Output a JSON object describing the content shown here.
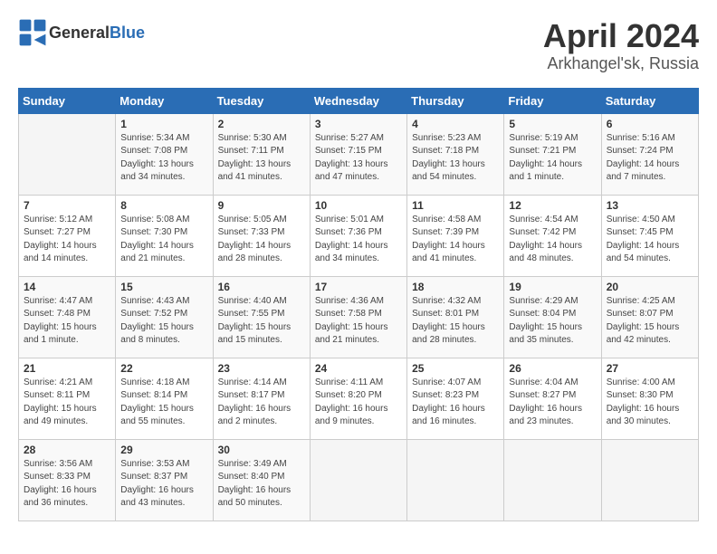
{
  "logo": {
    "general": "General",
    "blue": "Blue"
  },
  "title": "April 2024",
  "subtitle": "Arkhangel'sk, Russia",
  "days_of_week": [
    "Sunday",
    "Monday",
    "Tuesday",
    "Wednesday",
    "Thursday",
    "Friday",
    "Saturday"
  ],
  "weeks": [
    [
      {
        "day": "",
        "content": ""
      },
      {
        "day": "1",
        "content": "Sunrise: 5:34 AM\nSunset: 7:08 PM\nDaylight: 13 hours\nand 34 minutes."
      },
      {
        "day": "2",
        "content": "Sunrise: 5:30 AM\nSunset: 7:11 PM\nDaylight: 13 hours\nand 41 minutes."
      },
      {
        "day": "3",
        "content": "Sunrise: 5:27 AM\nSunset: 7:15 PM\nDaylight: 13 hours\nand 47 minutes."
      },
      {
        "day": "4",
        "content": "Sunrise: 5:23 AM\nSunset: 7:18 PM\nDaylight: 13 hours\nand 54 minutes."
      },
      {
        "day": "5",
        "content": "Sunrise: 5:19 AM\nSunset: 7:21 PM\nDaylight: 14 hours\nand 1 minute."
      },
      {
        "day": "6",
        "content": "Sunrise: 5:16 AM\nSunset: 7:24 PM\nDaylight: 14 hours\nand 7 minutes."
      }
    ],
    [
      {
        "day": "7",
        "content": "Sunrise: 5:12 AM\nSunset: 7:27 PM\nDaylight: 14 hours\nand 14 minutes."
      },
      {
        "day": "8",
        "content": "Sunrise: 5:08 AM\nSunset: 7:30 PM\nDaylight: 14 hours\nand 21 minutes."
      },
      {
        "day": "9",
        "content": "Sunrise: 5:05 AM\nSunset: 7:33 PM\nDaylight: 14 hours\nand 28 minutes."
      },
      {
        "day": "10",
        "content": "Sunrise: 5:01 AM\nSunset: 7:36 PM\nDaylight: 14 hours\nand 34 minutes."
      },
      {
        "day": "11",
        "content": "Sunrise: 4:58 AM\nSunset: 7:39 PM\nDaylight: 14 hours\nand 41 minutes."
      },
      {
        "day": "12",
        "content": "Sunrise: 4:54 AM\nSunset: 7:42 PM\nDaylight: 14 hours\nand 48 minutes."
      },
      {
        "day": "13",
        "content": "Sunrise: 4:50 AM\nSunset: 7:45 PM\nDaylight: 14 hours\nand 54 minutes."
      }
    ],
    [
      {
        "day": "14",
        "content": "Sunrise: 4:47 AM\nSunset: 7:48 PM\nDaylight: 15 hours\nand 1 minute."
      },
      {
        "day": "15",
        "content": "Sunrise: 4:43 AM\nSunset: 7:52 PM\nDaylight: 15 hours\nand 8 minutes."
      },
      {
        "day": "16",
        "content": "Sunrise: 4:40 AM\nSunset: 7:55 PM\nDaylight: 15 hours\nand 15 minutes."
      },
      {
        "day": "17",
        "content": "Sunrise: 4:36 AM\nSunset: 7:58 PM\nDaylight: 15 hours\nand 21 minutes."
      },
      {
        "day": "18",
        "content": "Sunrise: 4:32 AM\nSunset: 8:01 PM\nDaylight: 15 hours\nand 28 minutes."
      },
      {
        "day": "19",
        "content": "Sunrise: 4:29 AM\nSunset: 8:04 PM\nDaylight: 15 hours\nand 35 minutes."
      },
      {
        "day": "20",
        "content": "Sunrise: 4:25 AM\nSunset: 8:07 PM\nDaylight: 15 hours\nand 42 minutes."
      }
    ],
    [
      {
        "day": "21",
        "content": "Sunrise: 4:21 AM\nSunset: 8:11 PM\nDaylight: 15 hours\nand 49 minutes."
      },
      {
        "day": "22",
        "content": "Sunrise: 4:18 AM\nSunset: 8:14 PM\nDaylight: 15 hours\nand 55 minutes."
      },
      {
        "day": "23",
        "content": "Sunrise: 4:14 AM\nSunset: 8:17 PM\nDaylight: 16 hours\nand 2 minutes."
      },
      {
        "day": "24",
        "content": "Sunrise: 4:11 AM\nSunset: 8:20 PM\nDaylight: 16 hours\nand 9 minutes."
      },
      {
        "day": "25",
        "content": "Sunrise: 4:07 AM\nSunset: 8:23 PM\nDaylight: 16 hours\nand 16 minutes."
      },
      {
        "day": "26",
        "content": "Sunrise: 4:04 AM\nSunset: 8:27 PM\nDaylight: 16 hours\nand 23 minutes."
      },
      {
        "day": "27",
        "content": "Sunrise: 4:00 AM\nSunset: 8:30 PM\nDaylight: 16 hours\nand 30 minutes."
      }
    ],
    [
      {
        "day": "28",
        "content": "Sunrise: 3:56 AM\nSunset: 8:33 PM\nDaylight: 16 hours\nand 36 minutes."
      },
      {
        "day": "29",
        "content": "Sunrise: 3:53 AM\nSunset: 8:37 PM\nDaylight: 16 hours\nand 43 minutes."
      },
      {
        "day": "30",
        "content": "Sunrise: 3:49 AM\nSunset: 8:40 PM\nDaylight: 16 hours\nand 50 minutes."
      },
      {
        "day": "",
        "content": ""
      },
      {
        "day": "",
        "content": ""
      },
      {
        "day": "",
        "content": ""
      },
      {
        "day": "",
        "content": ""
      }
    ]
  ]
}
